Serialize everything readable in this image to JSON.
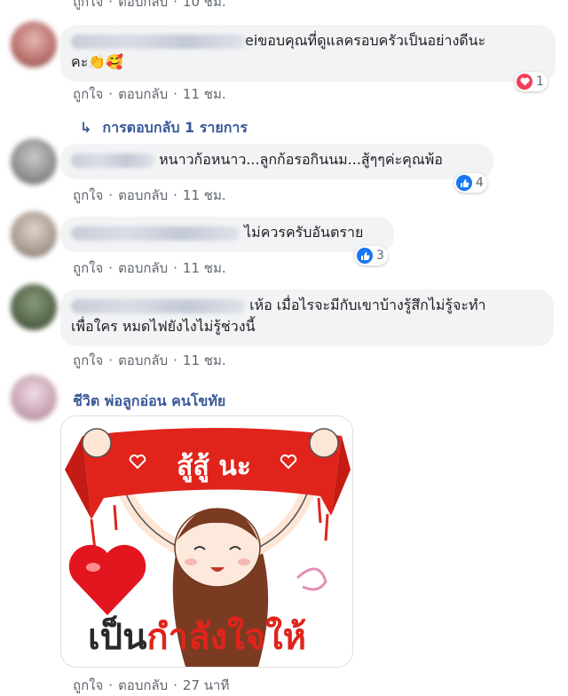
{
  "actions": {
    "like": "ถูกใจ",
    "reply": "ตอบกลับ",
    "sep": "·"
  },
  "top_partial": {
    "time": "10 ชม."
  },
  "comments": [
    {
      "text_line1": "eiขอบคุณที่ดูแลครอบครัวเป็นอย่างดีนะ",
      "text_line2": "คะ",
      "emoji": "👏🥰",
      "time": "11 ชม.",
      "reaction": {
        "icon": "heart-icon",
        "count": "1",
        "color": "#f33e58"
      }
    },
    {
      "text_line1": "หนาวก้อหนาว...ลูกก้อรอกินนม...สู้ๆๆค่ะคุณพ้อ",
      "time": "11 ชม.",
      "reaction": {
        "icon": "like-icon",
        "count": "4",
        "color": "#1877f2"
      }
    },
    {
      "text_line1": "ไม่ควรครับอันตราย",
      "time": "11 ชม.",
      "reaction": {
        "icon": "like-icon",
        "count": "3",
        "color": "#1877f2"
      }
    },
    {
      "text_line1": "เห้อ เมื่อไรจะมีกับเขาบ้างรู้สึกไม่รู้จะทำ",
      "text_line2": "เพื่อใคร หมดไฟยังไงไม่รู้ช่วงนี้",
      "time": "11 ชม."
    },
    {
      "author": "ชีวิต พ่อลูกอ่อน คนโขทัย",
      "time": "27 นาที",
      "sticker": {
        "banner": "สู้สู้ นะ",
        "caption_a": "เป็น",
        "caption_b": "กำลังใจให้"
      }
    }
  ],
  "replies_link": "การตอบกลับ 1 รายการ",
  "colors": {
    "link": "#385898",
    "bubble": "#f2f3f5",
    "meta": "#606770"
  }
}
